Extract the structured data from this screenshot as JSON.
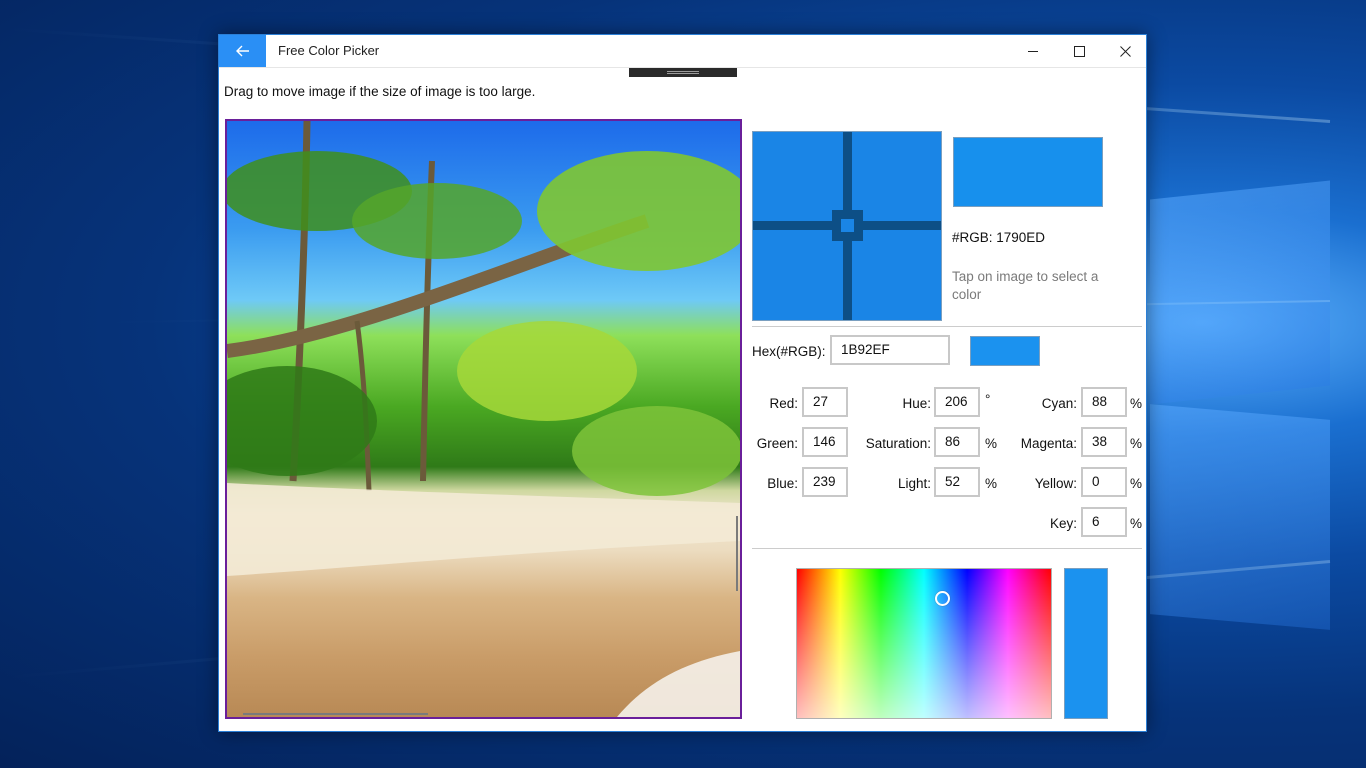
{
  "window": {
    "title": "Free Color Picker"
  },
  "image_panel": {
    "hint": "Drag to move image if the size of image is too large."
  },
  "picked": {
    "rgb_label": "#RGB: 1790ED",
    "color": "#1790ED",
    "tap_hint": "Tap on image to select a color"
  },
  "hex": {
    "label": "Hex(#RGB):",
    "value": "1B92EF",
    "color": "#1B92EF"
  },
  "rgb": {
    "red_label": "Red:",
    "red": "27",
    "green_label": "Green:",
    "green": "146",
    "blue_label": "Blue:",
    "blue": "239"
  },
  "hsl": {
    "hue_label": "Hue:",
    "hue": "206",
    "hue_unit": "°",
    "saturation_label": "Saturation:",
    "saturation": "86",
    "saturation_unit": "%",
    "light_label": "Light:",
    "light": "52",
    "light_unit": "%"
  },
  "cmyk": {
    "cyan_label": "Cyan:",
    "cyan": "88",
    "cyan_unit": "%",
    "magenta_label": "Magenta:",
    "magenta": "38",
    "magenta_unit": "%",
    "yellow_label": "Yellow:",
    "yellow": "0",
    "yellow_unit": "%",
    "key_label": "Key:",
    "key": "6",
    "key_unit": "%"
  },
  "icons": {
    "back": "back-arrow-icon",
    "minimize": "minimize-icon",
    "maximize": "maximize-icon",
    "close": "close-icon"
  }
}
